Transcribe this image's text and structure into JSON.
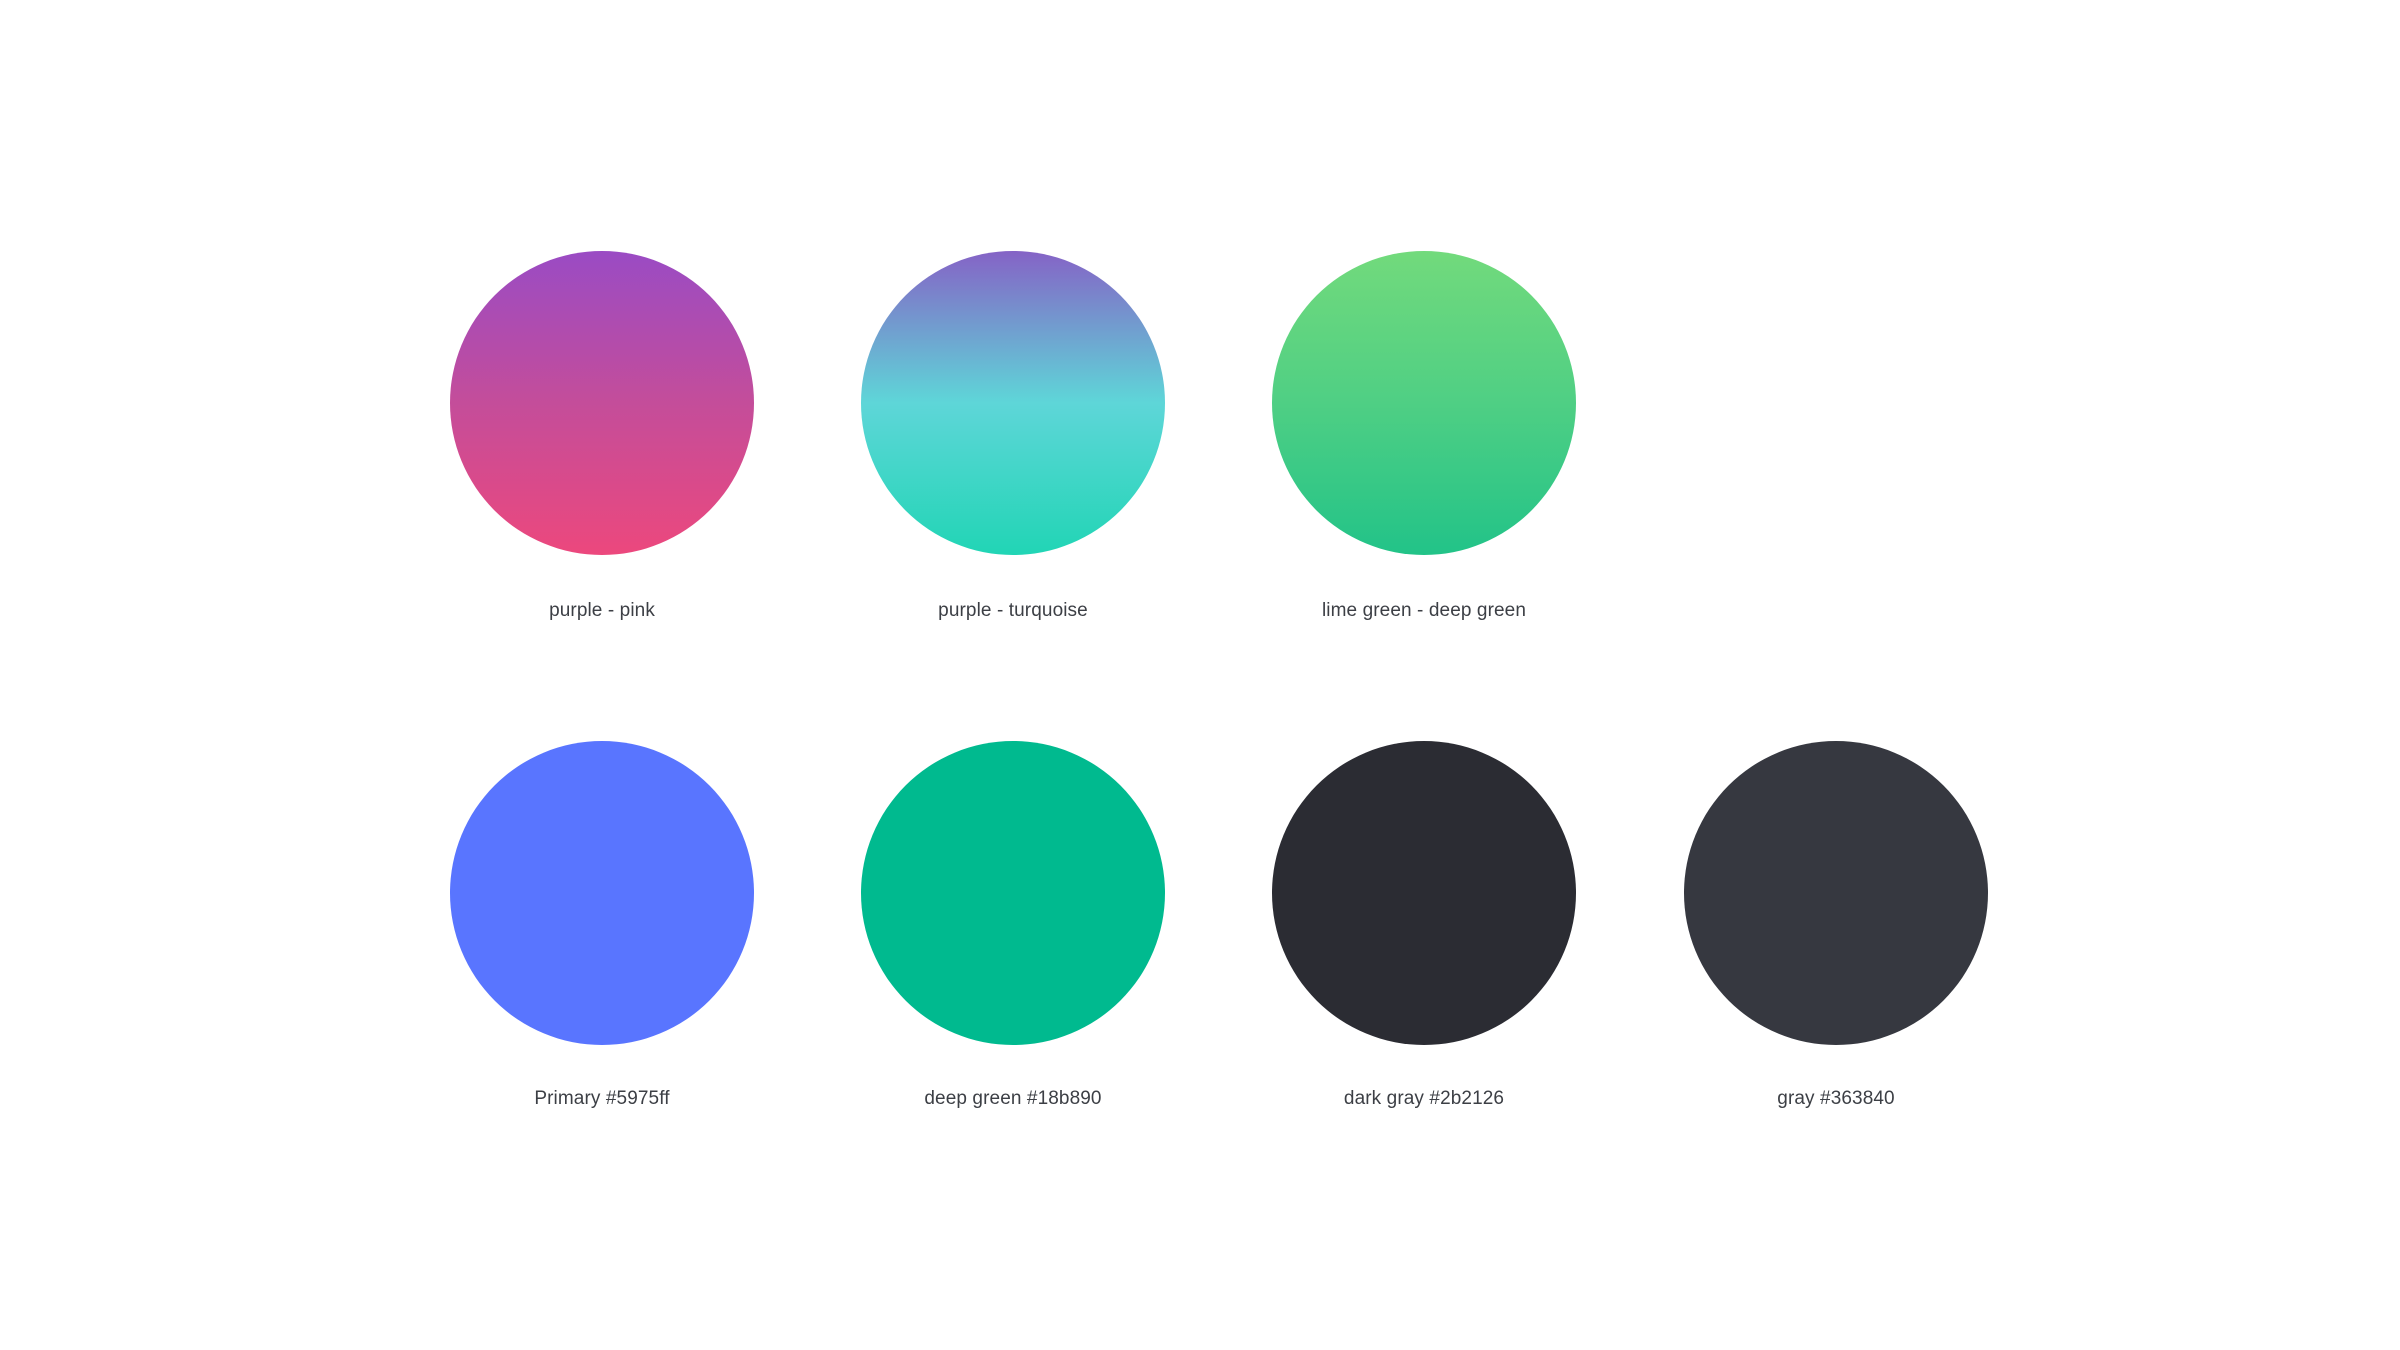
{
  "swatches": [
    {
      "label": "purple - pink",
      "gradient": [
        "#9a4bc4",
        "#c44d9a",
        "#ec487d"
      ]
    },
    {
      "label": "purple - turquoise",
      "gradient": [
        "#8563c6",
        "#5ed6d8",
        "#21d5b5"
      ]
    },
    {
      "label": "lime green - deep green",
      "gradient": [
        "#72da7c",
        "#4fcf84",
        "#22c388"
      ]
    },
    {
      "label": "Primary #5975ff",
      "color": "#5975ff"
    },
    {
      "label": "deep green #18b890",
      "color": "#00ba8f"
    },
    {
      "label": "dark gray #2b2126",
      "color": "#2b2c33"
    },
    {
      "label": "gray #363840",
      "color": "#363840"
    }
  ]
}
